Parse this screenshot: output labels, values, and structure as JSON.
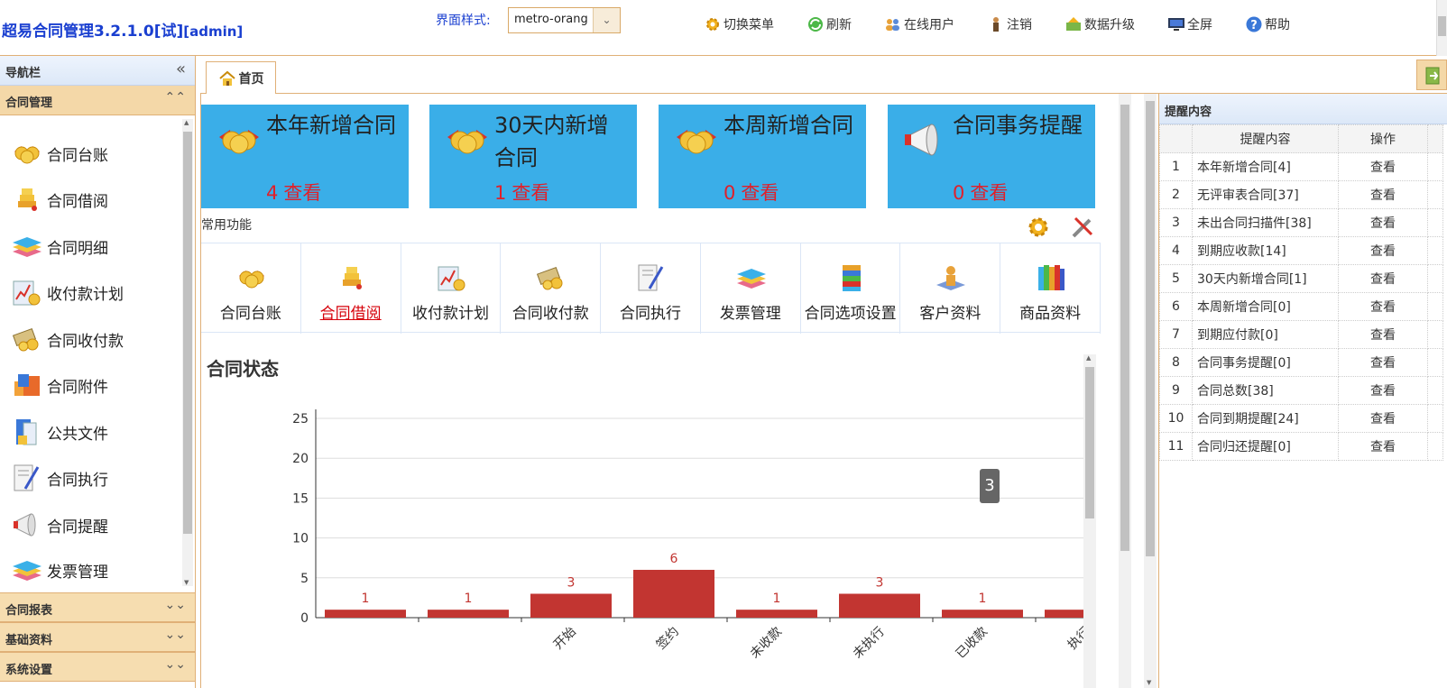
{
  "app": {
    "title": "超易合同管理3.2.1.0[试]",
    "user": "[admin]"
  },
  "theme": {
    "label": "界面样式:",
    "value": "metro-orang"
  },
  "toolbar": [
    {
      "label": "切换菜单",
      "icon": "gear-icon"
    },
    {
      "label": "刷新",
      "icon": "refresh-icon"
    },
    {
      "label": "在线用户",
      "icon": "users-icon"
    },
    {
      "label": "注销",
      "icon": "logout-icon"
    },
    {
      "label": "数据升级",
      "icon": "upgrade-icon"
    },
    {
      "label": "全屏",
      "icon": "monitor-icon"
    },
    {
      "label": "帮助",
      "icon": "help-icon"
    }
  ],
  "sidebar": {
    "title": "导航栏",
    "sections": [
      {
        "label": "合同管理",
        "expanded": true
      },
      {
        "label": "合同报表",
        "expanded": false
      },
      {
        "label": "基础资料",
        "expanded": false
      },
      {
        "label": "系统设置",
        "expanded": false
      }
    ],
    "items": [
      {
        "label": "合同台账",
        "icon": "coins-ribbon-icon"
      },
      {
        "label": "合同借阅",
        "icon": "gold-stack-icon"
      },
      {
        "label": "合同明细",
        "icon": "book-stack-icon"
      },
      {
        "label": "收付款计划",
        "icon": "chart-coins-icon"
      },
      {
        "label": "合同收付款",
        "icon": "money-icon"
      },
      {
        "label": "合同附件",
        "icon": "attachment-icon"
      },
      {
        "label": "公共文件",
        "icon": "documents-icon"
      },
      {
        "label": "合同执行",
        "icon": "execute-icon"
      },
      {
        "label": "合同提醒",
        "icon": "megaphone-icon"
      },
      {
        "label": "发票管理",
        "icon": "invoice-icon"
      }
    ]
  },
  "tabs": [
    {
      "label": "首页",
      "icon": "home-icon"
    }
  ],
  "cards": [
    {
      "title": "本年新增合同",
      "count": "4",
      "link": "查看",
      "icon": "coins-ribbon-icon"
    },
    {
      "title": "30天内新增合同",
      "count": "1",
      "link": "查看",
      "icon": "coins-ribbon-icon"
    },
    {
      "title": "本周新增合同",
      "count": "0",
      "link": "查看",
      "icon": "coins-ribbon-icon"
    },
    {
      "title": "合同事务提醒",
      "count": "0",
      "link": "查看",
      "icon": "megaphone-icon"
    }
  ],
  "common": {
    "label": "常用功能",
    "functions": [
      {
        "label": "合同台账",
        "icon": "coins-ribbon-icon"
      },
      {
        "label": "合同借阅",
        "icon": "gold-stack-icon",
        "active": true
      },
      {
        "label": "收付款计划",
        "icon": "chart-coins-icon"
      },
      {
        "label": "合同收付款",
        "icon": "money-icon"
      },
      {
        "label": "合同执行",
        "icon": "execute-icon"
      },
      {
        "label": "发票管理",
        "icon": "invoice-icon"
      },
      {
        "label": "合同选项设置",
        "icon": "books-icon"
      },
      {
        "label": "客户资料",
        "icon": "customer-icon"
      },
      {
        "label": "商品资料",
        "icon": "binders-icon"
      }
    ]
  },
  "chart_data": {
    "type": "bar",
    "title": "合同状态",
    "categories": [
      "",
      "",
      "开始",
      "签约",
      "未收款",
      "未执行",
      "已收款",
      "执行"
    ],
    "values": [
      1,
      1,
      3,
      6,
      1,
      3,
      1,
      1
    ],
    "ylim": [
      0,
      25
    ],
    "yticks": [
      0,
      5,
      10,
      15,
      20,
      25
    ],
    "grid": true,
    "bar_color": "#c23531",
    "tooltip_value": "3"
  },
  "reminders": {
    "title": "提醒内容",
    "columns": [
      "提醒内容",
      "操作"
    ],
    "rows": [
      {
        "n": "1",
        "content": "本年新增合同[4]",
        "op": "查看"
      },
      {
        "n": "2",
        "content": "无评审表合同[37]",
        "op": "查看"
      },
      {
        "n": "3",
        "content": "未出合同扫描件[38]",
        "op": "查看"
      },
      {
        "n": "4",
        "content": "到期应收款[14]",
        "op": "查看"
      },
      {
        "n": "5",
        "content": "30天内新增合同[1]",
        "op": "查看"
      },
      {
        "n": "6",
        "content": "本周新增合同[0]",
        "op": "查看"
      },
      {
        "n": "7",
        "content": "到期应付款[0]",
        "op": "查看"
      },
      {
        "n": "8",
        "content": "合同事务提醒[0]",
        "op": "查看"
      },
      {
        "n": "9",
        "content": "合同总数[38]",
        "op": "查看"
      },
      {
        "n": "10",
        "content": "合同到期提醒[24]",
        "op": "查看"
      },
      {
        "n": "11",
        "content": "合同归还提醒[0]",
        "op": "查看"
      }
    ]
  }
}
